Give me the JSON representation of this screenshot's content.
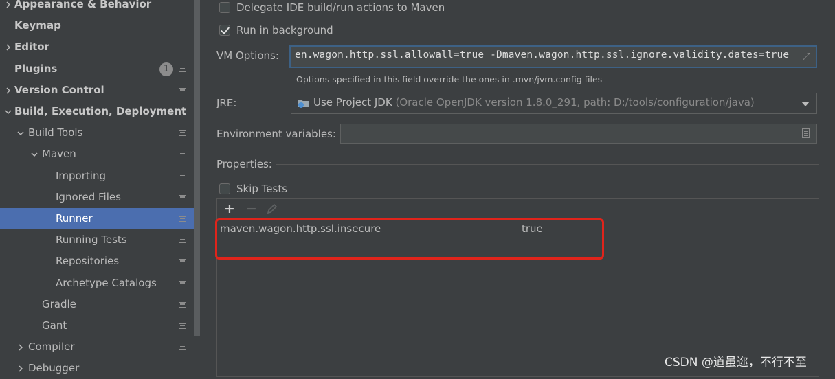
{
  "sidebar": {
    "items": [
      {
        "label": "Appearance & Behavior",
        "bold": true,
        "arrow": "right",
        "indent": 0
      },
      {
        "label": "Keymap",
        "bold": true,
        "arrow": "none",
        "indent": 0
      },
      {
        "label": "Editor",
        "bold": true,
        "arrow": "right",
        "indent": 0
      },
      {
        "label": "Plugins",
        "bold": true,
        "arrow": "none",
        "indent": 0,
        "badge": "1",
        "project_icon": true
      },
      {
        "label": "Version Control",
        "bold": true,
        "arrow": "right",
        "indent": 0,
        "project_icon": true
      },
      {
        "label": "Build, Execution, Deployment",
        "bold": true,
        "arrow": "down",
        "indent": 0
      },
      {
        "label": "Build Tools",
        "bold": false,
        "arrow": "down",
        "indent": 1,
        "project_icon": true
      },
      {
        "label": "Maven",
        "bold": false,
        "arrow": "down",
        "indent": 2,
        "project_icon": true
      },
      {
        "label": "Importing",
        "bold": false,
        "arrow": "none",
        "indent": 3,
        "project_icon": true
      },
      {
        "label": "Ignored Files",
        "bold": false,
        "arrow": "none",
        "indent": 3,
        "project_icon": true
      },
      {
        "label": "Runner",
        "bold": false,
        "arrow": "none",
        "indent": 3,
        "project_icon": true,
        "selected": true
      },
      {
        "label": "Running Tests",
        "bold": false,
        "arrow": "none",
        "indent": 3,
        "project_icon": true
      },
      {
        "label": "Repositories",
        "bold": false,
        "arrow": "none",
        "indent": 3,
        "project_icon": true
      },
      {
        "label": "Archetype Catalogs",
        "bold": false,
        "arrow": "none",
        "indent": 3,
        "project_icon": true
      },
      {
        "label": "Gradle",
        "bold": false,
        "arrow": "none",
        "indent": 2,
        "project_icon": true
      },
      {
        "label": "Gant",
        "bold": false,
        "arrow": "none",
        "indent": 2,
        "project_icon": true
      },
      {
        "label": "Compiler",
        "bold": false,
        "arrow": "right",
        "indent": 1,
        "project_icon": true
      },
      {
        "label": "Debugger",
        "bold": false,
        "arrow": "right",
        "indent": 1
      }
    ]
  },
  "runner": {
    "delegate_label": "Delegate IDE build/run actions to Maven",
    "delegate_checked": false,
    "background_label": "Run in background",
    "background_checked": true,
    "vm_label": "VM Options:",
    "vm_value": "en.wagon.http.ssl.allowall=true -Dmaven.wagon.http.ssl.ignore.validity.dates=true",
    "vm_hint": "Options specified in this field override the ones in .mvn/jvm.config files",
    "jre_label": "JRE:",
    "jre_value": "Use Project JDK",
    "jre_detail": "(Oracle OpenJDK version 1.8.0_291, path: D:/tools/configuration/java)",
    "env_label": "Environment variables:",
    "env_value": "",
    "properties_label": "Properties:",
    "skip_tests_label": "Skip Tests",
    "skip_tests_checked": false,
    "properties": [
      {
        "key": "maven.wagon.http.ssl.insecure",
        "value": "true"
      }
    ]
  },
  "watermark": "CSDN @道虽迩，不行不至",
  "colors": {
    "selection": "#4b6eaf",
    "highlight_box": "#e0241b",
    "background": "#3c3f41"
  }
}
